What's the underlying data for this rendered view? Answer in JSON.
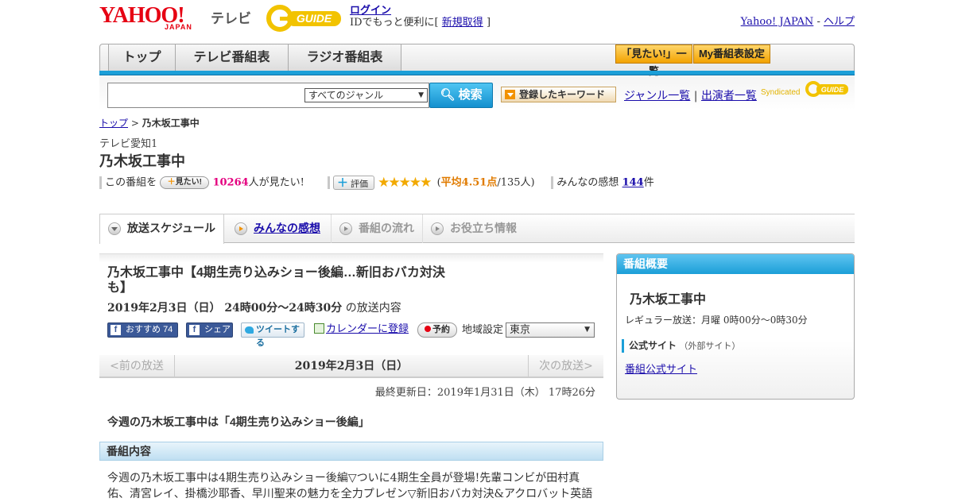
{
  "header": {
    "yahoo_logo": "YAHOO!",
    "yahoo_sub": "JAPAN",
    "tv_label": "テレビ",
    "gguide_logo": "GUIDE",
    "login": "ログイン",
    "id_text_prefix": "IDでもっと便利に[",
    "signup": "新規取得",
    "id_text_suffix": "]",
    "yahoo_japan_link": "Yahoo! JAPAN",
    "separator": "-",
    "help_link": "ヘルプ"
  },
  "nav": {
    "tabs": [
      {
        "label": "トップ"
      },
      {
        "label": "テレビ番組表"
      },
      {
        "label": "ラジオ番組表"
      }
    ],
    "mitai_list": "「見たい!」一覧",
    "my_schedule": "My番組表設定"
  },
  "search": {
    "genre_selected": "すべてのジャンル",
    "button": "検索",
    "keyword_button": "登録したキーワード",
    "genre_list": "ジャンル一覧",
    "divider": "|",
    "performer_list": "出演者一覧",
    "syndicated": "Syndicated"
  },
  "breadcrumb": {
    "top": "トップ",
    "sep": ">",
    "current": "乃木坂工事中"
  },
  "program": {
    "station": "テレビ愛知1",
    "title": "乃木坂工事中",
    "want_prefix": "この番組を",
    "want_button": "見たい!",
    "want_count": "10264",
    "want_suffix": "人が見たい!",
    "rate_button": "評価",
    "stars": "★★★★★",
    "rating_open": "(",
    "rating_avg": "平均4.51点",
    "rating_count": "/135人)",
    "comments_label": "みんなの感想",
    "comments_count": "144",
    "comments_unit": "件"
  },
  "tabs": [
    {
      "label": "放送スケジュール"
    },
    {
      "label": "みんなの感想"
    },
    {
      "label": "番組の流れ"
    },
    {
      "label": "お役立ち情報"
    }
  ],
  "episode": {
    "title": "乃木坂工事中【4期生売り込みショー後編…新旧おバカ対決も】",
    "date_time": "2019年2月3日（日） 24時00分～24時30分",
    "date_suffix": "の放送内容",
    "fb_recommend": "おすすめ",
    "fb_count": "74",
    "fb_share": "シェア",
    "tweet": "ツイートする",
    "calendar": "カレンダーに登録",
    "reserve": "予約",
    "region_label": "地域設定",
    "region_value": "東京"
  },
  "datenav": {
    "prev": "<前の放送",
    "current": "2019年2月3日（日）",
    "next": "次の放送>"
  },
  "updated": "最終更新日：2019年1月31日（木） 17時26分",
  "lead": "今週の乃木坂工事中は「4期生売り込みショー後編」",
  "section_head": "番組内容",
  "body_text": "今週の乃木坂工事中は4期生売り込みショー後編▽ついに4期生全員が登場!先輩コンビが田村真佑、清宮レイ、掛橋沙耶香、早川聖来の魅力を全力プレゼン▽新旧おバカ対決&アクロバット英語",
  "sidebar": {
    "head": "番組概要",
    "title": "乃木坂工事中",
    "regular": "レギュラー放送：月曜 0時00分～0時30分",
    "official_label": "公式サイト",
    "official_ext": "（外部サイト）",
    "official_link": "番組公式サイト"
  },
  "colors": {
    "brand_red": "#e60012",
    "accent_blue": "#1b9fd8",
    "gguide_yellow": "#f2c300",
    "want_pink": "#e4007f",
    "star_gold": "#f2a900"
  }
}
